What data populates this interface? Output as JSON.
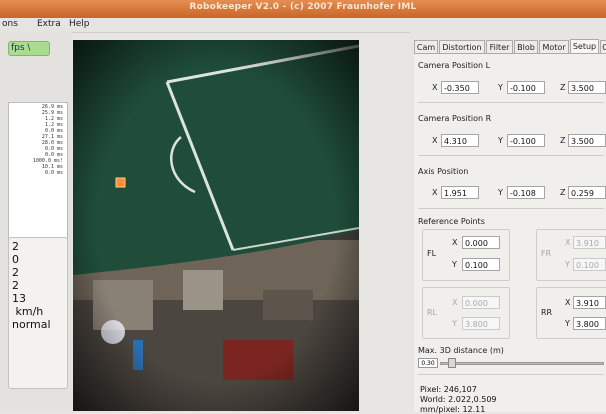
{
  "window": {
    "title": "Robokeeper V2.0 - (c) 2007 Fraunhofer IML"
  },
  "menu": {
    "items": [
      "ons",
      "Extra",
      "Help"
    ]
  },
  "left_panel": {
    "fps_button_label": "fps \\",
    "timing_lines": [
      "26.9 ms",
      "25.9 ms",
      "1.2 ms",
      "1.2 ms",
      "0.0 ms",
      "27.1 ms",
      "28.0 ms",
      "0.0 ms",
      "0.0 ms",
      "1000.0 ms!",
      "10.1 ms",
      "0.0 ms"
    ],
    "stats_lines": [
      "2",
      "0",
      "2",
      "2",
      "13",
      " km/h",
      "normal"
    ]
  },
  "tabs": [
    "Cam",
    "Distortion",
    "Filter",
    "Blob",
    "Motor",
    "Setup",
    "C"
  ],
  "active_tab": "Setup",
  "setup": {
    "camera_l": {
      "title": "Camera Position L",
      "x_label": "X",
      "x": "-0.350",
      "y_label": "Y",
      "y": "-0.100",
      "z_label": "Z",
      "z": "3.500"
    },
    "camera_r": {
      "title": "Camera Position R",
      "x_label": "X",
      "x": "4.310",
      "y_label": "Y",
      "y": "-0.100",
      "z_label": "Z",
      "z": "3.500"
    },
    "axis": {
      "title": "Axis Position",
      "x_label": "X",
      "x": "1.951",
      "y_label": "Y",
      "y": "-0.108",
      "z_label": "Z",
      "z": "0.259"
    },
    "reference_points": {
      "title": "Reference Points",
      "fl": {
        "name": "FL",
        "x_label": "X",
        "x": "0.000",
        "y_label": "Y",
        "y": "0.100"
      },
      "fr": {
        "name": "FR",
        "x_label": "X",
        "x": "3.910",
        "y_label": "Y",
        "y": "0.100"
      },
      "rl": {
        "name": "RL",
        "x_label": "X",
        "x": "0.000",
        "y_label": "Y",
        "y": "3.800"
      },
      "rr": {
        "name": "RR",
        "x_label": "X",
        "x": "3.910",
        "y_label": "Y",
        "y": "3.800"
      }
    },
    "max_distance": {
      "title": "Max. 3D distance (m)",
      "value": "0.30",
      "level": 0.05
    }
  },
  "status": {
    "pixel": "Pixel: 246,107",
    "world": "World: 2.022,0.509",
    "mm_per_pixel": "mm/pixel: 12.11"
  },
  "colors": {
    "titlebar": "#d0733a",
    "fps_button": "#a9dc8f",
    "field_green": "#1f4d3a"
  }
}
